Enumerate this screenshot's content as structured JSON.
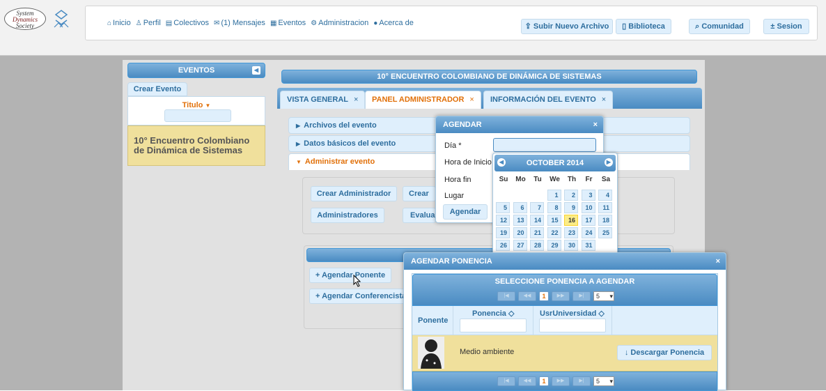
{
  "logo": {
    "line1": "System",
    "line2": "Dynamics",
    "line3": "Society"
  },
  "nav": [
    {
      "icon": "⌂",
      "label": "Inicio"
    },
    {
      "icon": "♙",
      "label": "Perfil"
    },
    {
      "icon": "▤",
      "label": "Colectivos"
    },
    {
      "icon": "✉",
      "label": "(1) Mensajes"
    },
    {
      "icon": "▦",
      "label": "Eventos"
    },
    {
      "icon": "⚙",
      "label": "Administracion"
    },
    {
      "icon": "●",
      "label": "Acerca de"
    }
  ],
  "top_buttons": {
    "upload": "⇪ Subir Nuevo Archivo",
    "library": "▯ Biblioteca",
    "community": "⌕ Comunidad",
    "session": "± Sesion"
  },
  "sidebar": {
    "header": "EVENTOS",
    "create": "Crear Evento",
    "column": "Titulo",
    "event": "10° Encuentro Colombiano de Dinámica de Sistemas"
  },
  "main": {
    "title": "10° ENCUENTRO COLOMBIANO DE DINÁMICA DE SISTEMAS",
    "tabs": [
      "VISTA GENERAL",
      "PANEL ADMINISTRADOR",
      "INFORMACIÓN DEL EVENTO"
    ],
    "tab_close": "×",
    "sections": [
      "Archivos del evento",
      "Datos básicos del evento",
      "Administrar evento"
    ],
    "buttons": [
      "Crear Administrador",
      "Crear E",
      "Administradores",
      "Evalua"
    ],
    "action_buttons": [
      "+ Agendar Ponente",
      "+ Agendar Conferencista"
    ]
  },
  "agendar_dialog": {
    "title": "AGENDAR",
    "close": "×",
    "fields": {
      "dia": "Día",
      "required_mark": "*",
      "hora_inicio": "Hora de Inicio",
      "hora_fin": "Hora fin",
      "lugar": "Lugar"
    },
    "submit": "Agendar"
  },
  "calendar": {
    "month": "OCTOBER 2014",
    "prev": "◀",
    "next": "▶",
    "days_of_week": [
      "Su",
      "Mo",
      "Tu",
      "We",
      "Th",
      "Fr",
      "Sa"
    ],
    "today": "16",
    "days": [
      "1",
      "2",
      "3",
      "4",
      "5",
      "6",
      "7",
      "8",
      "9",
      "10",
      "11",
      "12",
      "13",
      "14",
      "15",
      "16",
      "17",
      "18",
      "19",
      "20",
      "21",
      "22",
      "23",
      "24",
      "25",
      "26",
      "27",
      "28",
      "29",
      "30",
      "31"
    ]
  },
  "ponencia_dialog": {
    "title": "AGENDAR PONENCIA",
    "close": "×",
    "table_title": "SELECCIONE PONENCIA A AGENDAR",
    "columns": {
      "ponente": "Ponente",
      "ponencia": "Ponencia ◇",
      "universidad": "UsrUniversidad ◇"
    },
    "page": "1",
    "rows_per_page": "5",
    "pager_first": "|◀",
    "pager_prev": "◀◀",
    "pager_next": "▶▶",
    "pager_last": "▶|",
    "row": {
      "ponencia": "Medio ambiente",
      "download": "↓ Descargar Ponencia"
    }
  }
}
